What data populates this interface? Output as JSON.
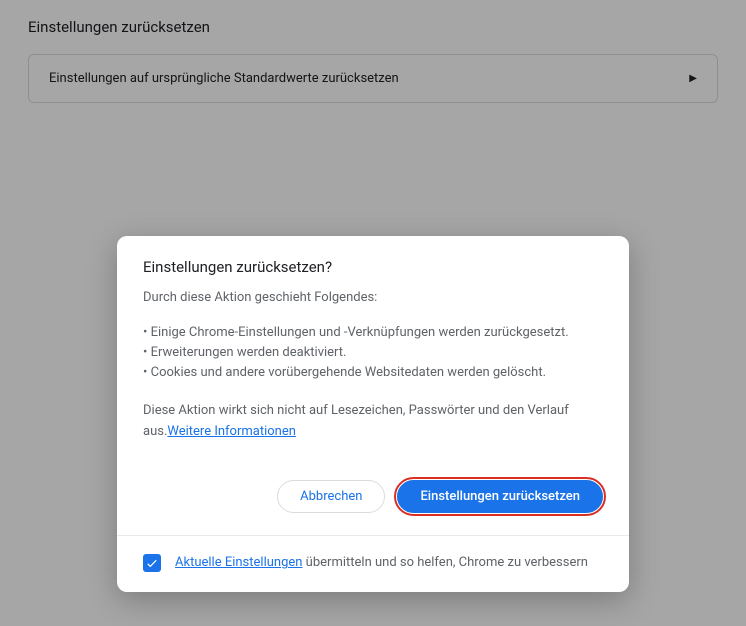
{
  "page": {
    "title": "Einstellungen zurücksetzen",
    "row_label": "Einstellungen auf ursprüngliche Standardwerte zurücksetzen"
  },
  "dialog": {
    "title": "Einstellungen zurücksetzen?",
    "lead": "Durch diese Aktion geschieht Folgendes:",
    "bullets": {
      "b1": "• Einige Chrome-Einstellungen und -Verknüpfungen werden zurückgesetzt.",
      "b2": "• Erweiterungen werden deaktiviert.",
      "b3": "• Cookies und andere vorübergehende Websitedaten werden gelöscht."
    },
    "foot_pre": "Diese Aktion wirkt sich nicht auf Lesezeichen, Passwörter und den Verlauf aus.",
    "foot_link": "Weitere Informationen",
    "cancel": "Abbrechen",
    "confirm": "Einstellungen zurücksetzen",
    "footer_link": "Aktuelle Einstellungen",
    "footer_rest": " übermitteln und so helfen, Chrome zu verbessern",
    "checkbox_checked": true
  }
}
